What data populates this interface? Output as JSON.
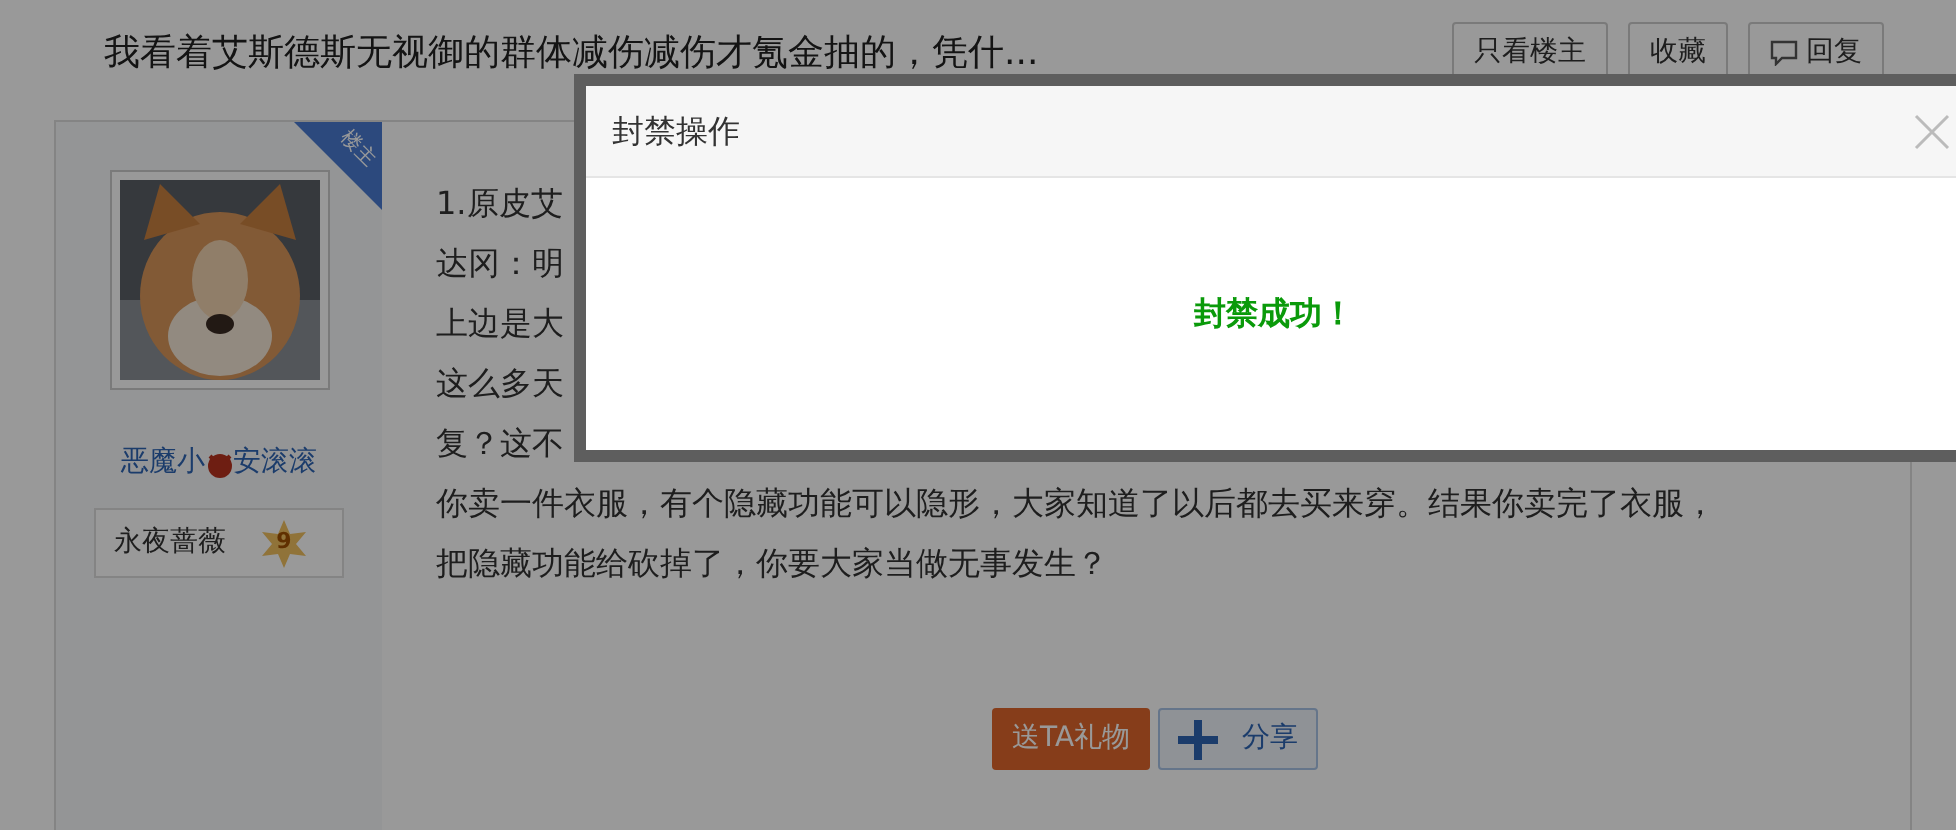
{
  "thread": {
    "title": "我看着艾斯德斯无视御的群体减伤减伤才氪金抽的，凭什...",
    "buttons": [
      {
        "kind": "plain",
        "label": "只看楼主"
      },
      {
        "kind": "plain",
        "label": "收藏"
      },
      {
        "kind": "reply",
        "label": "回复"
      }
    ]
  },
  "post": {
    "author_badge": "楼主",
    "author": {
      "name_before": "恶魔小",
      "name_after": "安滚滚",
      "title": "永夜蔷薇",
      "level": "9"
    },
    "lines": [
      "1.原皮艾",
      "达冈：明",
      "上边是大",
      "这么多天",
      "复？这不",
      "你卖一件衣服，有个隐藏功能可以隐形，大家知道了以后都去买来穿。结果你卖完了衣服，",
      "把隐藏功能给砍掉了，你要大家当做无事发生？"
    ],
    "actions": [
      {
        "kind": "gift",
        "label": "送TA礼物"
      },
      {
        "kind": "share",
        "label": "分享"
      }
    ]
  },
  "dialog": {
    "title": "封禁操作",
    "message": "封禁成功！"
  }
}
